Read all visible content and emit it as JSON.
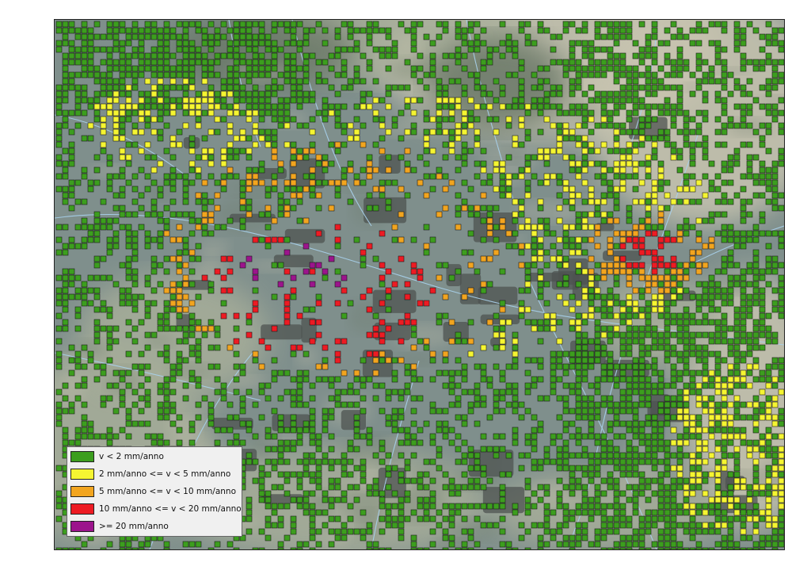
{
  "map": {
    "background_colors": {
      "plain": "#7f8f8c",
      "hill_light": "#c8c4b0",
      "hill_mid": "#a7ae9a",
      "hill_dark": "#6b7868",
      "urban": "#4d5350",
      "river": "#a9d1ec"
    }
  },
  "legend": {
    "items": [
      {
        "label": "v < 2 mm/anno",
        "color": "#3c9e1e"
      },
      {
        "label": "2 mm/anno <= v < 5 mm/anno",
        "color": "#f5f532"
      },
      {
        "label": "5 mm/anno <= v < 10 mm/anno",
        "color": "#f2a51f"
      },
      {
        "label": "10 mm/anno <= v < 20 mm/anno",
        "color": "#ed1b23"
      },
      {
        "label": ">= 20 mm/anno",
        "color": "#9c148c"
      }
    ]
  }
}
